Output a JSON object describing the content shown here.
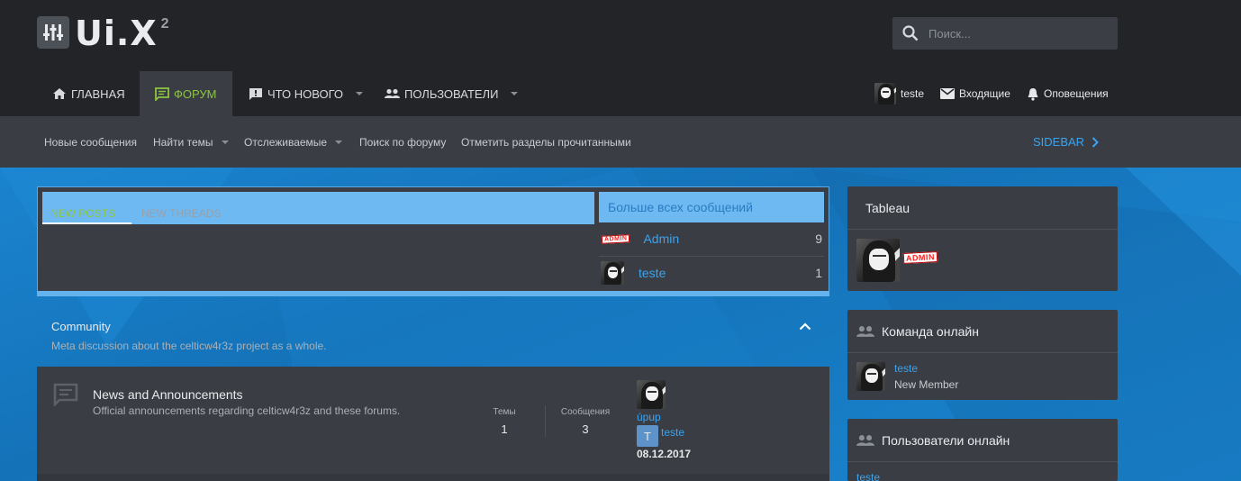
{
  "logo": {
    "text": "Ui.X",
    "sup": "2"
  },
  "search": {
    "placeholder": "Поиск..."
  },
  "nav": {
    "items": [
      {
        "label": "ГЛАВНАЯ"
      },
      {
        "label": "ФОРУМ"
      },
      {
        "label": "ЧТО НОВОГО"
      },
      {
        "label": "ПОЛЬЗОВАТЕЛИ"
      }
    ],
    "user": "teste",
    "inbox": "Входящие",
    "alerts": "Оповещения"
  },
  "subnav": {
    "items": [
      {
        "label": "Новые сообщения"
      },
      {
        "label": "Найти темы"
      },
      {
        "label": "Отслеживаемые"
      },
      {
        "label": "Поиск по форуму"
      },
      {
        "label": "Отметить разделы прочитанными"
      }
    ],
    "sidebar": "SIDEBAR"
  },
  "tabs": {
    "new_posts": "NEW POSTS",
    "new_threads": "NEW THREADS"
  },
  "top_posters": {
    "title": "Больше всех сообщений",
    "rows": [
      {
        "name": "Admin",
        "count": "9"
      },
      {
        "name": "teste",
        "count": "1"
      }
    ]
  },
  "admin_badge": "ADMIN",
  "category": {
    "title": "Community",
    "description": "Meta discussion about the celticw4r3z project as a whole."
  },
  "forum": {
    "title": "News and Announcements",
    "description": "Official announcements regarding celticw4r3z and these forums.",
    "threads_label": "Темы",
    "threads_value": "1",
    "posts_label": "Сообщения",
    "posts_value": "3",
    "last_thread": "úpup",
    "last_user_initial": "T",
    "last_user": "teste",
    "last_date": "08.12.2017"
  },
  "widgets": {
    "tableau": {
      "title": "Tableau"
    },
    "staff": {
      "title": "Команда онлайн",
      "user": "teste",
      "role": "New Member"
    },
    "online": {
      "title": "Пользователи онлайн",
      "user": "teste"
    }
  },
  "colors": {
    "accent_green": "#8cc63f",
    "link_blue": "#3ba4f0",
    "bg_blue": "#1a7fc7"
  }
}
